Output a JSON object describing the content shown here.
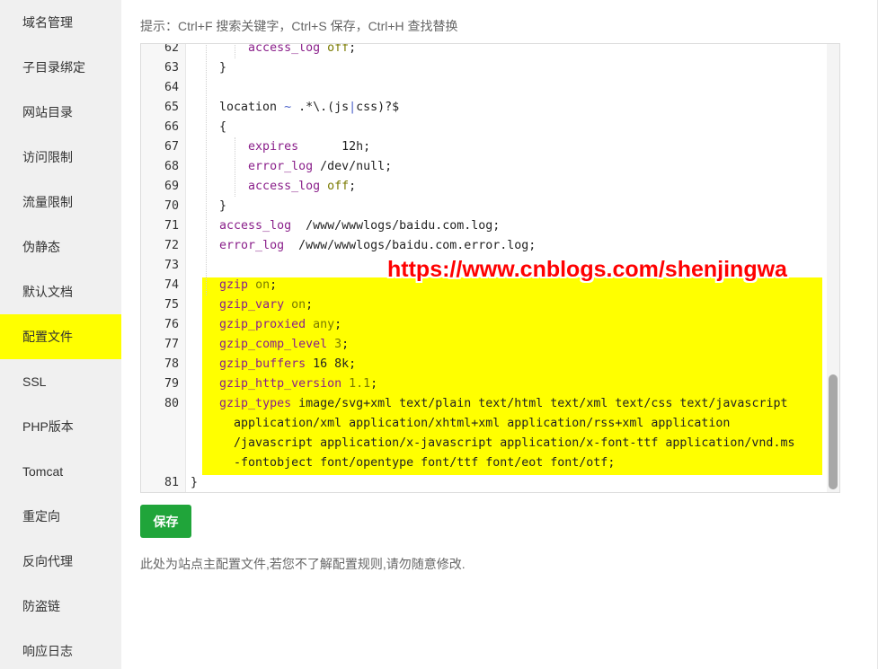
{
  "sidebar": {
    "items": [
      {
        "label": "域名管理",
        "active": false
      },
      {
        "label": "子目录绑定",
        "active": false
      },
      {
        "label": "网站目录",
        "active": false
      },
      {
        "label": "访问限制",
        "active": false
      },
      {
        "label": "流量限制",
        "active": false
      },
      {
        "label": "伪静态",
        "active": false
      },
      {
        "label": "默认文档",
        "active": false
      },
      {
        "label": "配置文件",
        "active": true
      },
      {
        "label": "SSL",
        "active": false
      },
      {
        "label": "PHP版本",
        "active": false
      },
      {
        "label": "Tomcat",
        "active": false
      },
      {
        "label": "重定向",
        "active": false
      },
      {
        "label": "反向代理",
        "active": false
      },
      {
        "label": "防盗链",
        "active": false
      },
      {
        "label": "响应日志",
        "active": false
      }
    ]
  },
  "hint": "提示：Ctrl+F 搜索关键字，Ctrl+S 保存，Ctrl+H 查找替换",
  "editor": {
    "lines": [
      {
        "num": "62",
        "text": "        access_log off;"
      },
      {
        "num": "63",
        "text": "    }"
      },
      {
        "num": "64",
        "text": ""
      },
      {
        "num": "65",
        "text": "    location ~ .*\\.(js|css)?$"
      },
      {
        "num": "66",
        "text": "    {"
      },
      {
        "num": "67",
        "text": "        expires      12h;"
      },
      {
        "num": "68",
        "text": "        error_log /dev/null;"
      },
      {
        "num": "69",
        "text": "        access_log off;"
      },
      {
        "num": "70",
        "text": "    }"
      },
      {
        "num": "71",
        "text": "    access_log  /www/wwwlogs/baidu.com.log;"
      },
      {
        "num": "72",
        "text": "    error_log  /www/wwwlogs/baidu.com.error.log;"
      },
      {
        "num": "73",
        "text": ""
      },
      {
        "num": "74",
        "text": "    gzip on;"
      },
      {
        "num": "75",
        "text": "    gzip_vary on;"
      },
      {
        "num": "76",
        "text": "    gzip_proxied any;"
      },
      {
        "num": "77",
        "text": "    gzip_comp_level 3;"
      },
      {
        "num": "78",
        "text": "    gzip_buffers 16 8k;"
      },
      {
        "num": "79",
        "text": "    gzip_http_version 1.1;"
      },
      {
        "num": "80",
        "text": "    gzip_types image/svg+xml text/plain text/html text/xml text/css text/javascript"
      },
      {
        "num": "",
        "text": "      application/xml application/xhtml+xml application/rss+xml application"
      },
      {
        "num": "",
        "text": "      /javascript application/x-javascript application/x-font-ttf application/vnd.ms"
      },
      {
        "num": "",
        "text": "      -fontobject font/opentype font/ttf font/eot font/otf;"
      },
      {
        "num": "81",
        "text": "}"
      }
    ],
    "highlight_color": "#ffff00"
  },
  "watermark": "https://www.cnblogs.com/shenjingwa",
  "save_label": "保存",
  "footer_note": "此处为站点主配置文件,若您不了解配置规则,请勿随意修改.",
  "colors": {
    "accent": "#20a53a",
    "active_sidebar": "#ffff00",
    "watermark": "#ff0000"
  }
}
